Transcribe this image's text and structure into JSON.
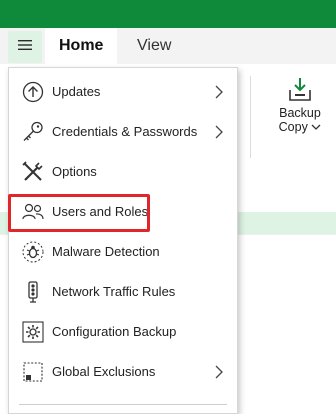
{
  "app": {
    "titlebar_color": "#0f8a3b",
    "menu_button_icon": "hamburger-icon"
  },
  "tabs": [
    {
      "label": "Home",
      "active": true
    },
    {
      "label": "View",
      "active": false
    }
  ],
  "ribbon": {
    "backup_copy": {
      "line1": "Backup",
      "line2": "Copy",
      "icon": "backup-copy-icon"
    }
  },
  "main_menu": {
    "items": [
      {
        "label": "Updates",
        "icon": "arrow-up-icon",
        "has_submenu": true
      },
      {
        "label": "Credentials & Passwords",
        "icon": "key-icon",
        "has_submenu": true
      },
      {
        "label": "Options",
        "icon": "tools-icon",
        "has_submenu": false
      },
      {
        "label": "Users and Roles",
        "icon": "users-icon",
        "has_submenu": false,
        "highlighted": true
      },
      {
        "label": "Malware Detection",
        "icon": "bug-icon",
        "has_submenu": false
      },
      {
        "label": "Network Traffic Rules",
        "icon": "traffic-light-icon",
        "has_submenu": false
      },
      {
        "label": "Configuration Backup",
        "icon": "gear-icon",
        "has_submenu": false
      },
      {
        "label": "Global Exclusions",
        "icon": "exclusion-icon",
        "has_submenu": true
      }
    ],
    "highlight_color": "#e0252b"
  }
}
